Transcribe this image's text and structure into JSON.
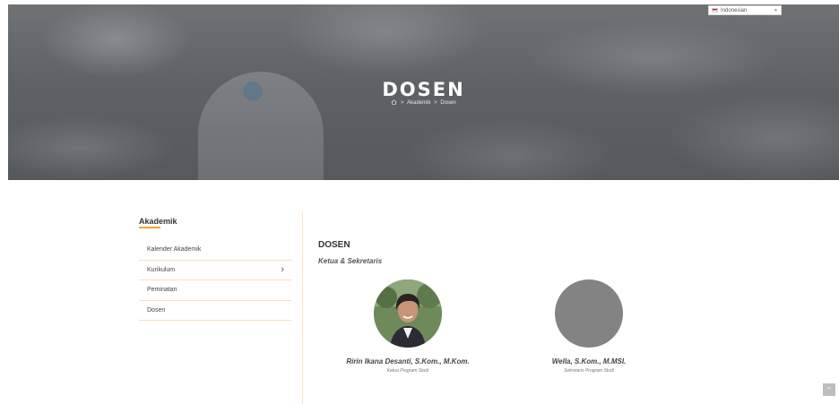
{
  "language": {
    "selected": "Indonesian"
  },
  "hero": {
    "title": "DOSEN",
    "breadcrumb": [
      "Akademik",
      "Dosen"
    ],
    "separator": ">"
  },
  "sidebar": {
    "title": "Akademik",
    "items": [
      {
        "label": "Kalender Akademik",
        "has_submenu": false
      },
      {
        "label": "Kurikulum",
        "has_submenu": true
      },
      {
        "label": "Peminatan",
        "has_submenu": false
      },
      {
        "label": "Dosen",
        "has_submenu": false
      }
    ]
  },
  "content": {
    "title": "DOSEN",
    "subtitle": "Ketua & Sekretaris",
    "people": [
      {
        "name": "Ririn Ikana Desanti, S.Kom., M.Kom.",
        "role": "Ketua Program Studi"
      },
      {
        "name": "Wella, S.Kom., M.MSI.",
        "role": "Sekretaris Program Studi"
      }
    ]
  },
  "colors": {
    "accent": "#f0a533",
    "divider": "#f6e2c7",
    "avatar_placeholder": "#838383"
  },
  "icons": {
    "home": "home-icon",
    "chevron": "chevron-right-icon",
    "scroll_top": "chevron-up-icon"
  }
}
